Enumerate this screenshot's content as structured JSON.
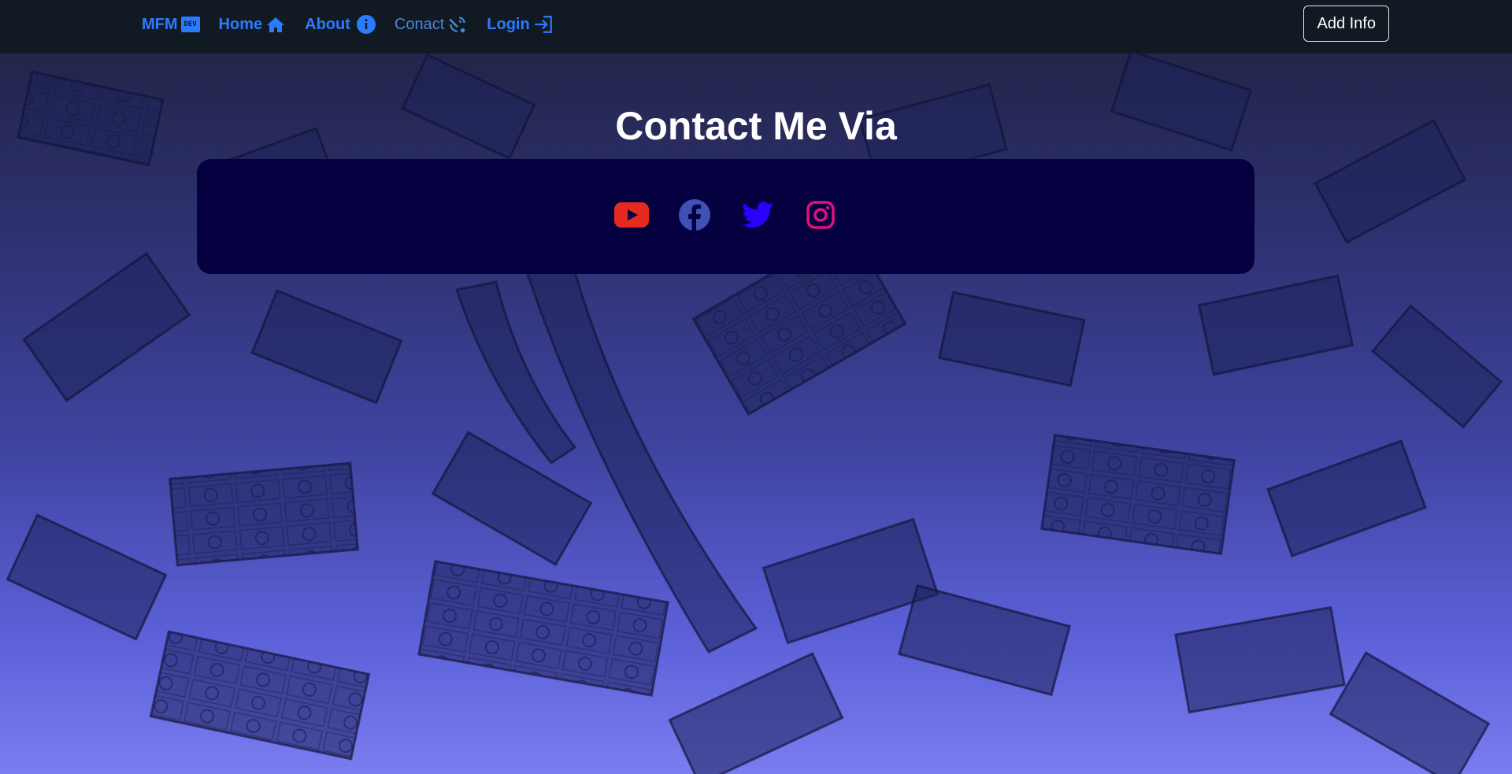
{
  "nav": {
    "brand": "MFM",
    "brand_badge": "DEV",
    "links": [
      {
        "label": "Home",
        "icon": "house-icon"
      },
      {
        "label": "About",
        "icon": "info-circle-icon"
      },
      {
        "label": "Conact",
        "icon": "satellite-dish-icon"
      },
      {
        "label": "Login",
        "icon": "login-arrow-icon"
      }
    ],
    "add_info_label": "Add Info"
  },
  "main": {
    "title": "Contact Me Via",
    "socials": [
      {
        "name": "youtube",
        "icon": "youtube-icon",
        "color": "#e62b1e"
      },
      {
        "name": "facebook",
        "icon": "facebook-icon",
        "color": "#3f51b5"
      },
      {
        "name": "twitter",
        "icon": "twitter-icon",
        "color": "#2a00ff"
      },
      {
        "name": "instagram",
        "icon": "instagram-icon",
        "color": "#e0127a"
      }
    ]
  },
  "colors": {
    "nav_bg": "#111a22",
    "link": "#2b7bff",
    "card_bg": "#050040"
  }
}
